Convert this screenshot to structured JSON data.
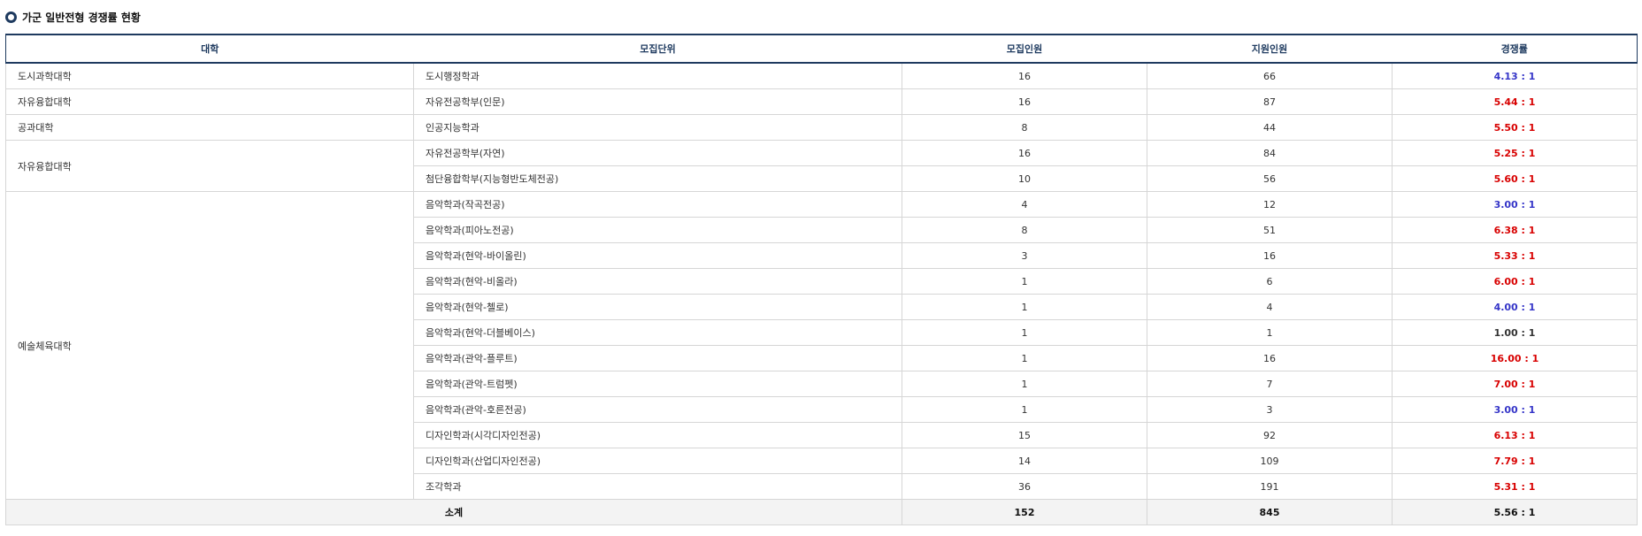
{
  "section_title": "가군 일반전형 경쟁률 현황",
  "headers": [
    "대학",
    "모집단위",
    "모집인원",
    "지원인원",
    "경쟁률"
  ],
  "rows": [
    {
      "college": "도시과학대학",
      "unit": "도시행정학과",
      "quota": "16",
      "applicants": "66",
      "rate": "4.13 : 1",
      "rate_color": "blue"
    },
    {
      "college": "자유융합대학",
      "unit": "자유전공학부(인문)",
      "quota": "16",
      "applicants": "87",
      "rate": "5.44 : 1",
      "rate_color": "red"
    },
    {
      "college": "공과대학",
      "unit": "인공지능학과",
      "quota": "8",
      "applicants": "44",
      "rate": "5.50 : 1",
      "rate_color": "red"
    },
    {
      "college": "자유융합대학",
      "unit": "자유전공학부(자연)",
      "quota": "16",
      "applicants": "84",
      "rate": "5.25 : 1",
      "rate_color": "red"
    },
    {
      "college": "",
      "unit": "첨단융합학부(지능형반도체전공)",
      "quota": "10",
      "applicants": "56",
      "rate": "5.60 : 1",
      "rate_color": "red"
    },
    {
      "college": "예술체육대학",
      "unit": "음악학과(작곡전공)",
      "quota": "4",
      "applicants": "12",
      "rate": "3.00 : 1",
      "rate_color": "blue"
    },
    {
      "college": "",
      "unit": "음악학과(피아노전공)",
      "quota": "8",
      "applicants": "51",
      "rate": "6.38 : 1",
      "rate_color": "red"
    },
    {
      "college": "",
      "unit": "음악학과(현악-바이올린)",
      "quota": "3",
      "applicants": "16",
      "rate": "5.33 : 1",
      "rate_color": "red"
    },
    {
      "college": "",
      "unit": "음악학과(현악-비올라)",
      "quota": "1",
      "applicants": "6",
      "rate": "6.00 : 1",
      "rate_color": "red"
    },
    {
      "college": "",
      "unit": "음악학과(현악-첼로)",
      "quota": "1",
      "applicants": "4",
      "rate": "4.00 : 1",
      "rate_color": "blue"
    },
    {
      "college": "",
      "unit": "음악학과(현악-더블베이스)",
      "quota": "1",
      "applicants": "1",
      "rate": "1.00 : 1",
      "rate_color": "black"
    },
    {
      "college": "",
      "unit": "음악학과(관악-플루트)",
      "quota": "1",
      "applicants": "16",
      "rate": "16.00 : 1",
      "rate_color": "red"
    },
    {
      "college": "",
      "unit": "음악학과(관악-트럼펫)",
      "quota": "1",
      "applicants": "7",
      "rate": "7.00 : 1",
      "rate_color": "red"
    },
    {
      "college": "",
      "unit": "음악학과(관악-호른전공)",
      "quota": "1",
      "applicants": "3",
      "rate": "3.00 : 1",
      "rate_color": "blue"
    },
    {
      "college": "",
      "unit": "디자인학과(시각디자인전공)",
      "quota": "15",
      "applicants": "92",
      "rate": "6.13 : 1",
      "rate_color": "red"
    },
    {
      "college": "",
      "unit": "디자인학과(산업디자인전공)",
      "quota": "14",
      "applicants": "109",
      "rate": "7.79 : 1",
      "rate_color": "red"
    },
    {
      "college": "",
      "unit": "조각학과",
      "quota": "36",
      "applicants": "191",
      "rate": "5.31 : 1",
      "rate_color": "red"
    }
  ],
  "total": {
    "label": "소계",
    "quota": "152",
    "applicants": "845",
    "rate": "5.56 : 1",
    "rate_color": "red"
  },
  "colors": {
    "blue": "#3535c8",
    "red": "#d80000",
    "black": "#333333",
    "header_navy": "#1e3a5f"
  }
}
